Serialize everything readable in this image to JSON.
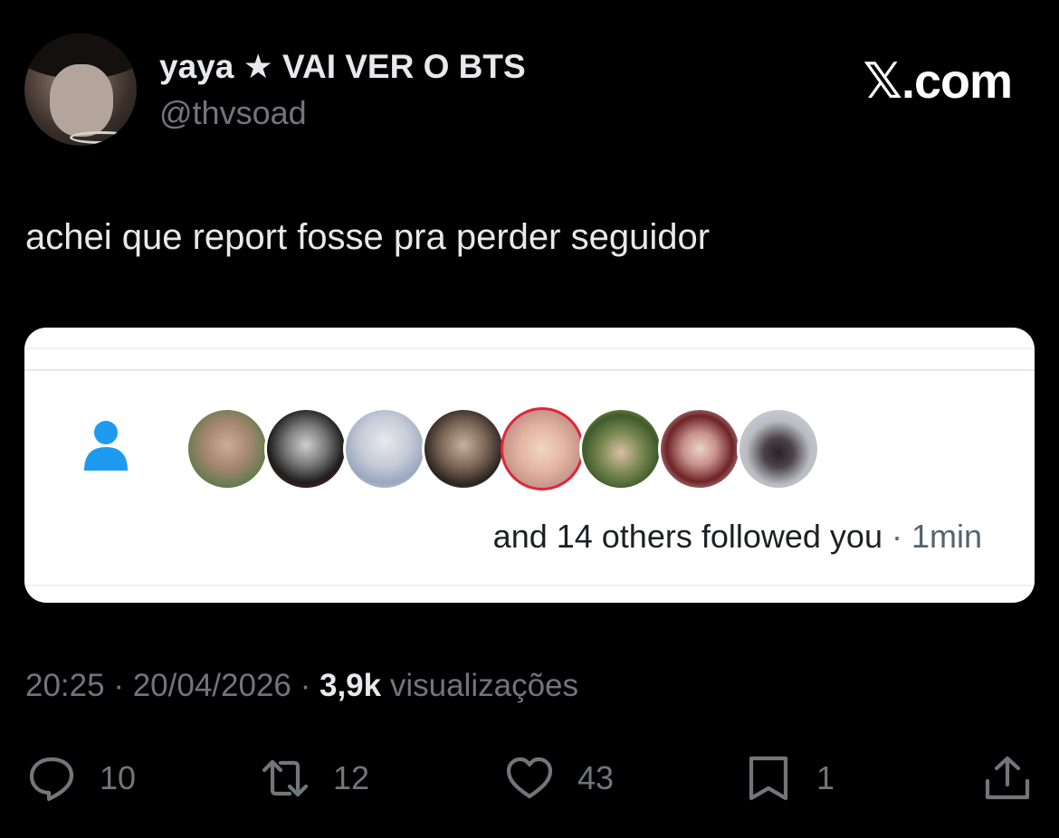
{
  "author": {
    "display_name": "yaya ★ VAI VER O BTS",
    "handle": "@thvsoad"
  },
  "brand": {
    "glyph": "𝕏",
    "text": ".com"
  },
  "tweet": {
    "text": "achei que report fosse pra perder seguidor"
  },
  "embedded_screenshot": {
    "notification": "and 14 others followed you",
    "separator": " · ",
    "time": "1min",
    "icon": "person-icon",
    "accent_color": "#1d9bf0",
    "avatar_count": 8
  },
  "meta": {
    "time": "20:25",
    "date": "20/04/2026",
    "views_count": "3,9k",
    "views_label": "visualizações"
  },
  "actions": {
    "replies": "10",
    "reposts": "12",
    "likes": "43",
    "bookmarks": "1"
  }
}
